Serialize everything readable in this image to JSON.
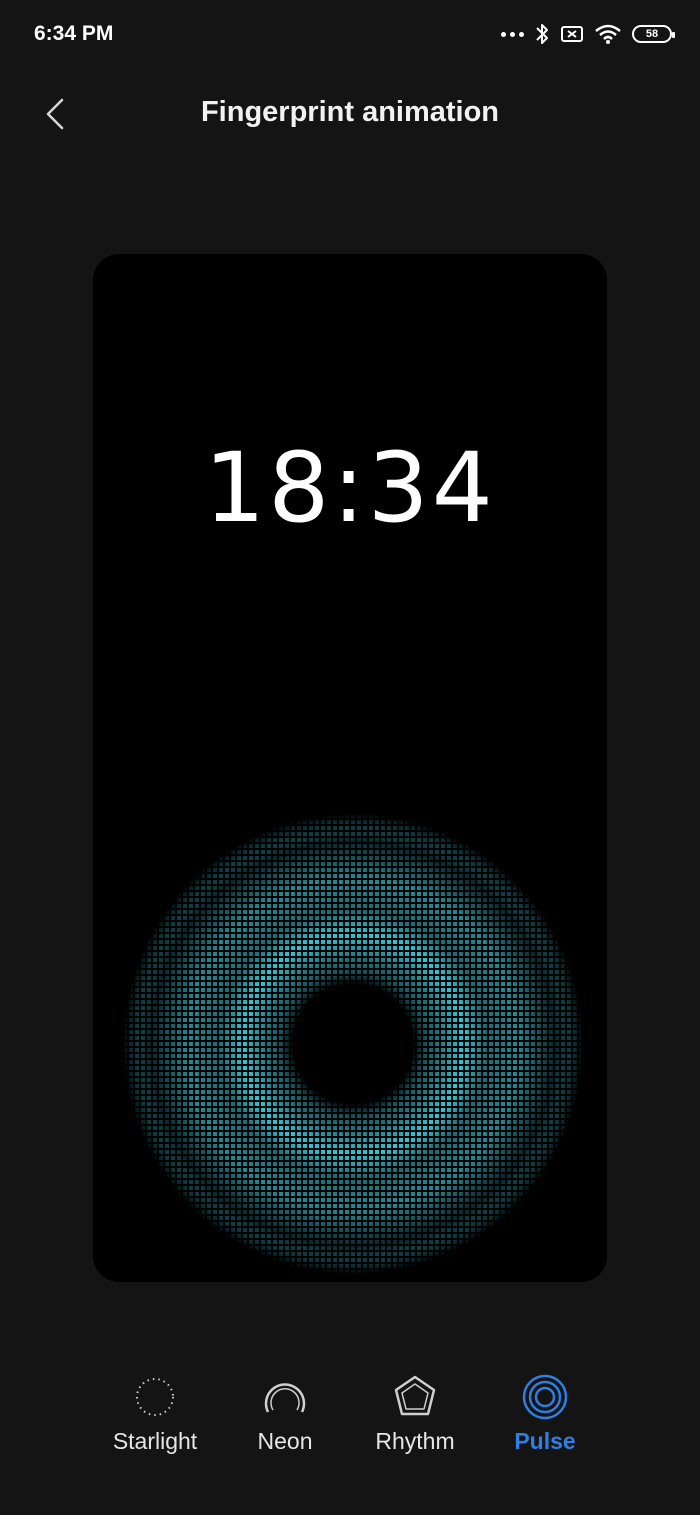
{
  "status_bar": {
    "time": "6:34 PM",
    "battery_level": "58",
    "icons": [
      "more-dots-icon",
      "bluetooth-icon",
      "sim-error-icon",
      "wifi-icon",
      "battery-icon"
    ]
  },
  "header": {
    "title": "Fingerprint animation",
    "back_icon": "chevron-left-icon"
  },
  "preview": {
    "clock": "18:34",
    "animation": "pulse",
    "glow_color": "#1fb7c9"
  },
  "options": [
    {
      "label": "Starlight",
      "icon": "starlight-icon",
      "selected": false
    },
    {
      "label": "Neon",
      "icon": "neon-icon",
      "selected": false
    },
    {
      "label": "Rhythm",
      "icon": "rhythm-icon",
      "selected": false
    },
    {
      "label": "Pulse",
      "icon": "pulse-icon",
      "selected": true
    }
  ],
  "colors": {
    "background": "#141414",
    "card": "#000000",
    "accent": "#2f7fe0",
    "text": "#ffffff"
  }
}
